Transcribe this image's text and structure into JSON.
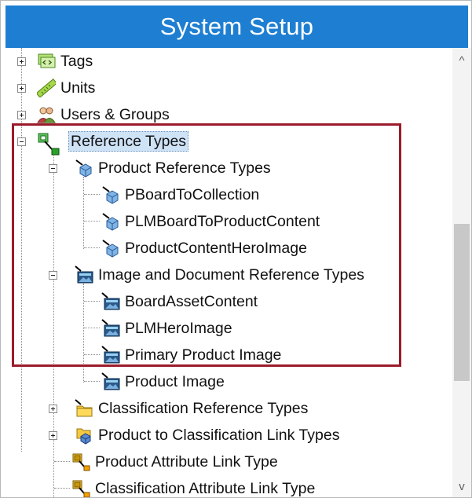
{
  "window": {
    "title": "System Setup"
  },
  "tree": [
    {
      "key": "tags",
      "label": "Tags",
      "icon": "tags-icon",
      "expander": "plus"
    },
    {
      "key": "units",
      "label": "Units",
      "icon": "ruler-icon",
      "expander": "plus"
    },
    {
      "key": "users",
      "label": "Users & Groups",
      "icon": "users-groups-icon",
      "expander": "plus"
    },
    {
      "key": "ref_types",
      "label": "Reference Types",
      "icon": "reference-types-icon",
      "expander": "minus",
      "selected": true
    },
    {
      "key": "product_ref",
      "label": "Product Reference Types",
      "icon": "product-cube-icon",
      "expander": "minus"
    },
    {
      "key": "pboard",
      "label": "PBoardToCollection",
      "icon": "product-cube-icon"
    },
    {
      "key": "plmboard",
      "label": "PLMBoardToProductContent",
      "icon": "product-cube-icon"
    },
    {
      "key": "pchero",
      "label": "ProductContentHeroImage",
      "icon": "product-cube-icon"
    },
    {
      "key": "image_doc",
      "label": "Image and Document Reference Types",
      "icon": "image-icon",
      "expander": "minus"
    },
    {
      "key": "boardasset",
      "label": "BoardAssetContent",
      "icon": "image-icon"
    },
    {
      "key": "plmhero",
      "label": "PLMHeroImage",
      "icon": "image-icon"
    },
    {
      "key": "primary_img",
      "label": "Primary Product Image",
      "icon": "image-icon"
    },
    {
      "key": "product_img",
      "label": "Product Image",
      "icon": "image-icon"
    },
    {
      "key": "class_ref",
      "label": "Classification Reference Types",
      "icon": "folder-icon",
      "expander": "plus"
    },
    {
      "key": "prod_class_link",
      "label": "Product to Classification Link Types",
      "icon": "link-types-icon",
      "expander": "plus"
    },
    {
      "key": "prod_attr_link",
      "label": "Product Attribute Link Type",
      "icon": "attribute-link-icon"
    },
    {
      "key": "class_attr_link",
      "label": "Classification Attribute Link Type",
      "icon": "attribute-link-icon"
    }
  ],
  "scrollbar": {
    "up": "^",
    "down": "v"
  },
  "colors": {
    "title_bar": "#1e7fd2",
    "highlight_box": "#9b1b2a",
    "selection": "#cfe3f7"
  }
}
